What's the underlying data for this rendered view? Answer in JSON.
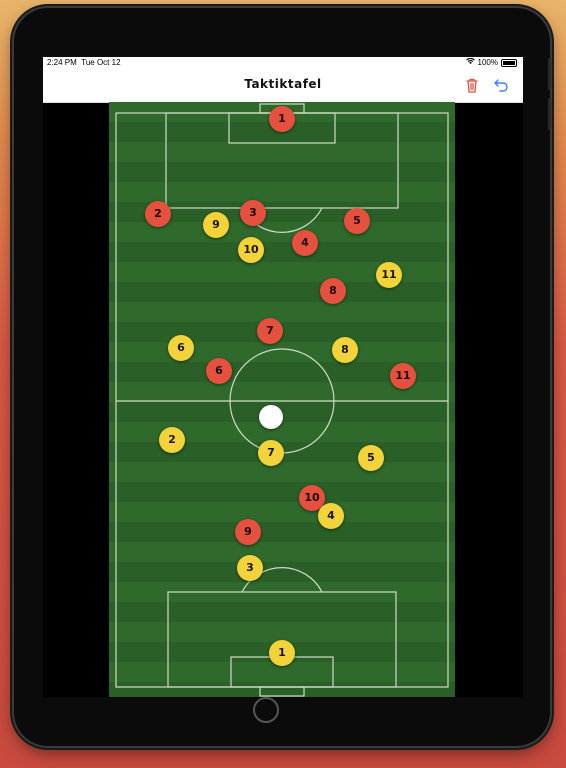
{
  "status_bar": {
    "time": "2:24 PM",
    "date": "Tue Oct 12",
    "battery": "100%"
  },
  "nav": {
    "title": "Taktiktafel",
    "trash_icon": "trash-icon",
    "undo_icon": "undo-icon",
    "accent_color": "#3a82f7",
    "trash_color": "#e5503f"
  },
  "colors": {
    "red_team": "#e5503f",
    "yellow_team": "#f2d33a",
    "ball": "#ffffff"
  },
  "red_players": [
    "1",
    "2",
    "3",
    "5",
    "4",
    "8",
    "7",
    "6",
    "11",
    "10",
    "9"
  ],
  "yellow_players": [
    "9",
    "10",
    "11",
    "6",
    "8",
    "2",
    "7",
    "5",
    "4",
    "3",
    "1"
  ]
}
